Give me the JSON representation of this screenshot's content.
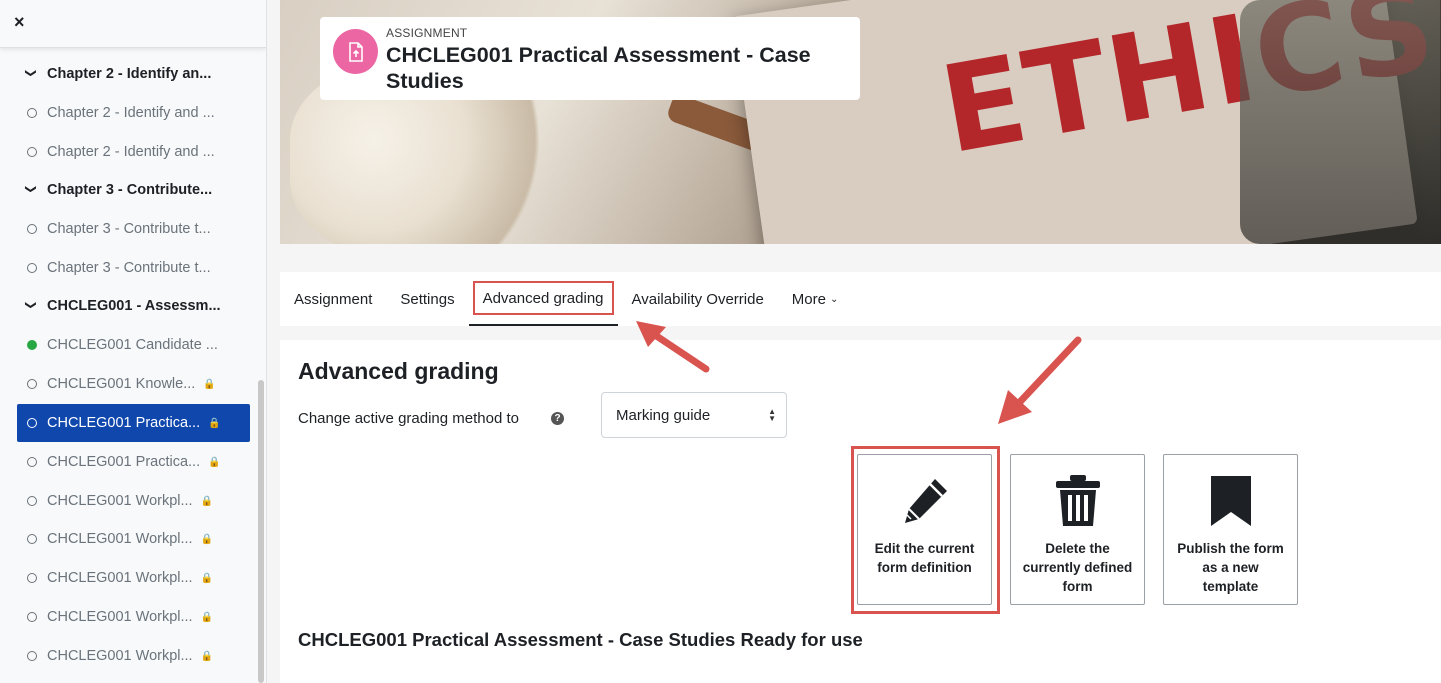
{
  "sidebar": {
    "close_label": "×",
    "items": [
      {
        "type": "section",
        "label": "Chapter 2 - Identify an..."
      },
      {
        "type": "activity",
        "label": "Chapter 2 - Identify and ...",
        "status": "none"
      },
      {
        "type": "activity",
        "label": "Chapter 2 - Identify and ...",
        "status": "none"
      },
      {
        "type": "section",
        "label": "Chapter 3 - Contribute..."
      },
      {
        "type": "activity",
        "label": "Chapter 3 - Contribute t...",
        "status": "none"
      },
      {
        "type": "activity",
        "label": "Chapter 3 - Contribute t...",
        "status": "none"
      },
      {
        "type": "section",
        "label": "CHCLEG001 - Assessm..."
      },
      {
        "type": "activity",
        "label": "CHCLEG001 Candidate ...",
        "status": "complete"
      },
      {
        "type": "activity",
        "label": "CHCLEG001 Knowle...",
        "status": "none",
        "locked": true
      },
      {
        "type": "activity",
        "label": "CHCLEG001 Practica...",
        "status": "none",
        "locked": true,
        "active": true
      },
      {
        "type": "activity",
        "label": "CHCLEG001 Practica...",
        "status": "none",
        "locked": true
      },
      {
        "type": "activity",
        "label": "CHCLEG001 Workpl...",
        "status": "none",
        "locked": true
      },
      {
        "type": "activity",
        "label": "CHCLEG001 Workpl...",
        "status": "none",
        "locked": true
      },
      {
        "type": "activity",
        "label": "CHCLEG001 Workpl...",
        "status": "none",
        "locked": true
      },
      {
        "type": "activity",
        "label": "CHCLEG001 Workpl...",
        "status": "none",
        "locked": true
      },
      {
        "type": "activity",
        "label": "CHCLEG001 Workpl...",
        "status": "none",
        "locked": true
      }
    ]
  },
  "header": {
    "activity_type": "ASSIGNMENT",
    "title": "CHCLEG001 Practical Assessment - Case Studies",
    "banner_text": "ETHICS",
    "icon": "assignment-file-icon",
    "icon_color": "#eb66a2"
  },
  "tabs": [
    {
      "label": "Assignment"
    },
    {
      "label": "Settings"
    },
    {
      "label": "Advanced grading",
      "active": true
    },
    {
      "label": "Availability Override"
    },
    {
      "label": "More"
    }
  ],
  "main": {
    "heading": "Advanced grading",
    "method_label": "Change active grading method to",
    "method_value": "Marking guide",
    "help_icon": "question-circle-icon",
    "actions": [
      {
        "label": "Edit the current form definition",
        "icon": "pencil-icon"
      },
      {
        "label": "Delete the currently defined form",
        "icon": "trash-icon"
      },
      {
        "label": "Publish the form as a new template",
        "icon": "bookmark-icon"
      }
    ],
    "status_text": "CHCLEG001 Practical Assessment - Case Studies Ready for use"
  },
  "colors": {
    "active_nav": "#0f47ad",
    "highlight": "#d9534f",
    "complete": "#28a745"
  }
}
